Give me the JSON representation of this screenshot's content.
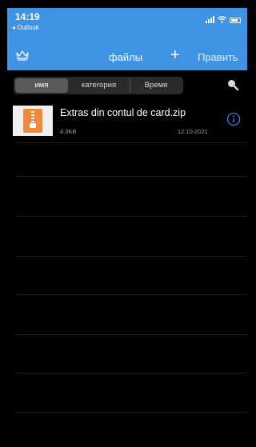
{
  "status": {
    "time": "14:19",
    "back_label": "◂ Outlook"
  },
  "nav": {
    "title": "файлы",
    "add_label": "+",
    "edit_label": "Править"
  },
  "segment": {
    "items": [
      "имя",
      "категория",
      "Время"
    ],
    "active": "имя"
  },
  "files": [
    {
      "name": "Extras din contul de card.zip",
      "size": "4.3KB",
      "date": "12.10.2021",
      "icon": "zip-file-icon"
    }
  ],
  "colors": {
    "header": "#3f93e5",
    "background": "#000000",
    "accent": "#3f7ee8",
    "zip": "#f08a3a"
  }
}
